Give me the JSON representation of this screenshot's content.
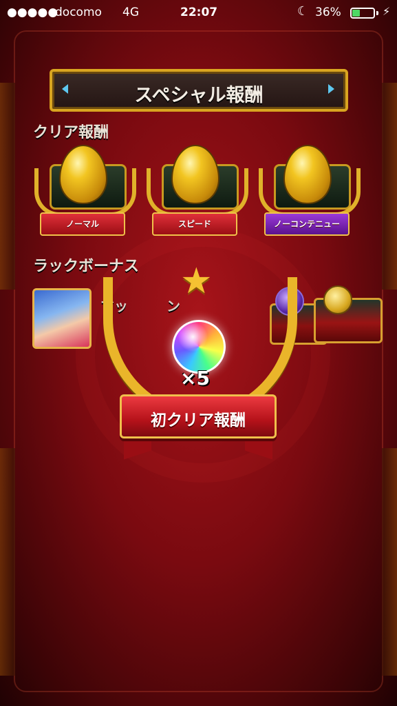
{
  "status_bar": {
    "signal": "●●●●●",
    "carrier": "docomo",
    "network": "4G",
    "time": "22:07",
    "battery_percent": "36%",
    "battery_level": 0.36,
    "moon_icon": "moon-icon",
    "bolt_icon": "charging-bolt-icon"
  },
  "title": "スペシャル報酬",
  "clear_rewards": {
    "heading": "クリア報酬",
    "items": [
      {
        "label": "ノーマル",
        "ribbon_color": "#c8141c"
      },
      {
        "label": "スピード",
        "ribbon_color": "#c8141c"
      },
      {
        "label": "ノーコンテニュー",
        "ribbon_color": "#8a2ad0"
      }
    ]
  },
  "luck_bonus": {
    "heading": "ラックボーナス",
    "monster_name": "マッ",
    "name_suffix": "ン"
  },
  "popup": {
    "reward_count": "×5",
    "label": "初クリア報酬"
  },
  "colors": {
    "background": "#7a0a10",
    "gold": "#eab52a",
    "ribbon_red": "#c8141c"
  }
}
